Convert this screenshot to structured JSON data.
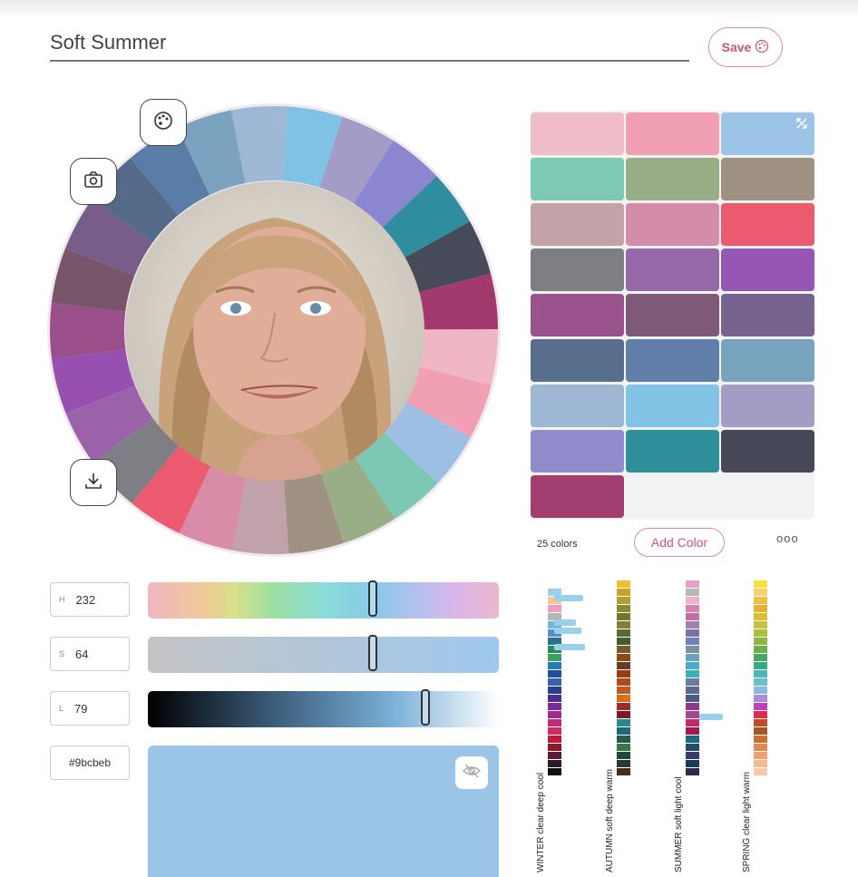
{
  "palette_name": "Soft Summer",
  "save_label": "Save",
  "palette_icon": "palette-icon",
  "camera_icon": "camera-icon",
  "download_icon": "download-icon",
  "eye_off_icon": "eye-off-icon",
  "expand_icon": "expand-icon",
  "wheel_colors": [
    "#9eb8d6",
    "#7fc2e6",
    "#a39cc6",
    "#8c86d0",
    "#2f8e9e",
    "#474a59",
    "#a23a6e",
    "#f0b6c4",
    "#f0a0b2",
    "#9dbfe3",
    "#7cc8b4",
    "#99ad87",
    "#a09282",
    "#c2a2aa",
    "#d98ca8",
    "#ec5a6f",
    "#7d7f85",
    "#9a62a8",
    "#9750b0",
    "#9a4e8a",
    "#79556b",
    "#785d8a",
    "#556a88",
    "#5a7da8",
    "#7ba2be"
  ],
  "swatches": [
    "#efbcc8",
    "#f0a0b2",
    "#9cc4e6",
    "#7dcab4",
    "#99ad87",
    "#a09282",
    "#c4a2aa",
    "#d48ca8",
    "#ec5a6f",
    "#7d7f85",
    "#9568a8",
    "#9656b4",
    "#9a528c",
    "#7e5a78",
    "#75638e",
    "#576e8c",
    "#5f7fa8",
    "#77a4bc",
    "#9eb8d4",
    "#82c3e6",
    "#a49cc4",
    "#938ccc",
    "#2f909c",
    "#474857",
    "#a23e70"
  ],
  "color_count": "25 colors",
  "add_color_label": "Add Color",
  "more_label": "ooo",
  "hsl": {
    "h_label": "H",
    "h_value": "232",
    "s_label": "S",
    "s_value": "64",
    "l_label": "L",
    "l_value": "79",
    "hex": "#9bcbeb"
  },
  "slider_levels": {
    "h": 0.64,
    "s": 0.64,
    "l": 0.79
  },
  "preview_color": "#9bc5e6",
  "seasons": [
    {
      "label": "WINTER  clear deep cool",
      "colors": [
        "#ffffff",
        "#9ad0ec",
        "#f4c88a",
        "#f29ac0",
        "#b5b5b5",
        "#6db8dc",
        "#5a8ec4",
        "#2a6f8a",
        "#2d8a5a",
        "#3da060",
        "#2a7ab8",
        "#1e4e9c",
        "#3b5fa8",
        "#2a3f8c",
        "#4a2e8a",
        "#7a2a9a",
        "#a02a8a",
        "#c02a7a",
        "#d02a5a",
        "#c01a3a",
        "#8a1a2a",
        "#5a1a3a",
        "#2a1a2a",
        "#111111"
      ]
    },
    {
      "label": "AUTUMN  soft deep warm",
      "colors": [
        "#f0c030",
        "#d0a020",
        "#b0a030",
        "#8a8a30",
        "#6a7a2a",
        "#8a7a3a",
        "#5a6a2a",
        "#4a5a2a",
        "#7a5a2a",
        "#8a4a1a",
        "#6a3a1a",
        "#9a3a1a",
        "#b04a1a",
        "#c05a20",
        "#d07020",
        "#a02a2a",
        "#7a1a2a",
        "#2a8a8a",
        "#1a6a7a",
        "#2a5a4a",
        "#3a7a4a",
        "#1a4a3a",
        "#2a3a2a",
        "#4a2a1a"
      ]
    },
    {
      "label": "SUMMER  soft light cool",
      "colors": [
        "#e8a0c8",
        "#b8b8b8",
        "#f4b0c8",
        "#e080b0",
        "#c070a0",
        "#a080b0",
        "#8070a0",
        "#7080c0",
        "#8090a0",
        "#6aa0c0",
        "#4aa8c8",
        "#3ab0b8",
        "#6a7aa0",
        "#5a6a90",
        "#4a5a88",
        "#8a3a8a",
        "#a04a8a",
        "#c02a6a",
        "#a01a4a",
        "#1a6a8a",
        "#2a4a6a",
        "#3a3a6a",
        "#1a3a5a",
        "#2a2a4a"
      ]
    },
    {
      "label": "SPRING  clear light warm",
      "colors": [
        "#f8e040",
        "#f8d070",
        "#f0c040",
        "#e8b030",
        "#d8c030",
        "#c8c040",
        "#a8c040",
        "#88b840",
        "#68b050",
        "#48a860",
        "#38a888",
        "#48b8b0",
        "#68c0c8",
        "#8ab8e0",
        "#a890d0",
        "#c040c0",
        "#e02a4a",
        "#c04a2a",
        "#a05a2a",
        "#d07030",
        "#e08a50",
        "#f0a070",
        "#f8b890",
        "#f8c8a8"
      ]
    }
  ]
}
